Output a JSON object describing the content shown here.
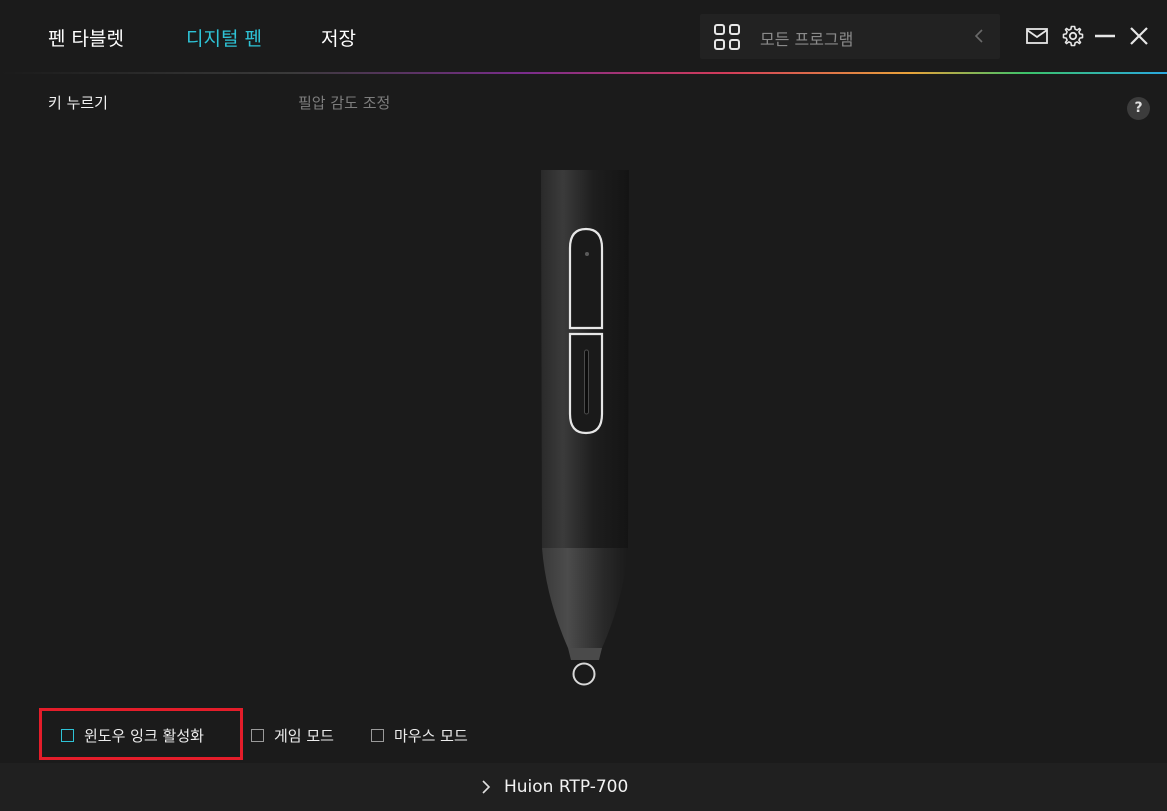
{
  "header": {
    "tabs": [
      {
        "label": "펜 타블렛",
        "active": false
      },
      {
        "label": "디지털 펜",
        "active": true
      },
      {
        "label": "저장",
        "active": false
      }
    ],
    "program_selector": {
      "label": "모든 프로그램"
    },
    "icons": [
      "grid-icon",
      "chevron-left-icon",
      "mail-icon",
      "gear-icon",
      "minimize-icon",
      "close-icon"
    ]
  },
  "subtabs": [
    {
      "label": "키 누르기",
      "active": true
    },
    {
      "label": "필압 감도 조정",
      "active": false
    }
  ],
  "help": {
    "label": "?"
  },
  "modes": {
    "windows_ink": {
      "label": "윈도우 잉크 활성화",
      "checked": false
    },
    "game_mode": {
      "label": "게임 모드",
      "checked": false
    },
    "mouse_mode": {
      "label": "마우스 모드",
      "checked": false
    }
  },
  "footer": {
    "device_name": "Huion RTP-700"
  },
  "colors": {
    "background": "#1b1b1b",
    "accent": "#2ec3d6",
    "highlight": "#e41d2a",
    "footer": "#202020"
  }
}
